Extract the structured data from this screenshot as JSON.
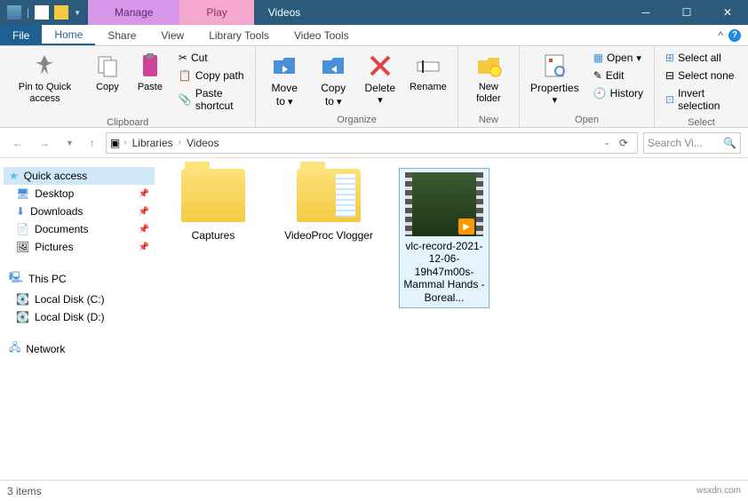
{
  "titlebar": {
    "ctx_tabs": {
      "manage": "Manage",
      "play": "Play"
    },
    "title": "Videos"
  },
  "tabs": {
    "file": "File",
    "home": "Home",
    "share": "Share",
    "view": "View",
    "library_tools": "Library Tools",
    "video_tools": "Video Tools"
  },
  "ribbon": {
    "clipboard": {
      "pin": "Pin to Quick access",
      "copy": "Copy",
      "paste": "Paste",
      "cut": "Cut",
      "copy_path": "Copy path",
      "paste_shortcut": "Paste shortcut",
      "label": "Clipboard"
    },
    "organize": {
      "move_to": "Move to",
      "copy_to": "Copy to",
      "delete": "Delete",
      "rename": "Rename",
      "label": "Organize"
    },
    "new": {
      "new_folder": "New folder",
      "label": "New"
    },
    "open": {
      "properties": "Properties",
      "open": "Open",
      "edit": "Edit",
      "history": "History",
      "label": "Open"
    },
    "select": {
      "select_all": "Select all",
      "select_none": "Select none",
      "invert": "Invert selection",
      "label": "Select"
    }
  },
  "breadcrumb": {
    "root": "Libraries",
    "current": "Videos"
  },
  "search": {
    "placeholder": "Search Vi..."
  },
  "nav": {
    "quick_access": "Quick access",
    "desktop": "Desktop",
    "downloads": "Downloads",
    "documents": "Documents",
    "pictures": "Pictures",
    "this_pc": "This PC",
    "local_c": "Local Disk (C:)",
    "local_d": "Local Disk (D:)",
    "network": "Network"
  },
  "items": {
    "captures": "Captures",
    "videoproc": "VideoProc Vlogger",
    "vlc": "vlc-record-2021-12-06-19h47m00s-Mammal Hands - Boreal..."
  },
  "status": {
    "count": "3 items",
    "watermark": "wsxdn.com"
  }
}
